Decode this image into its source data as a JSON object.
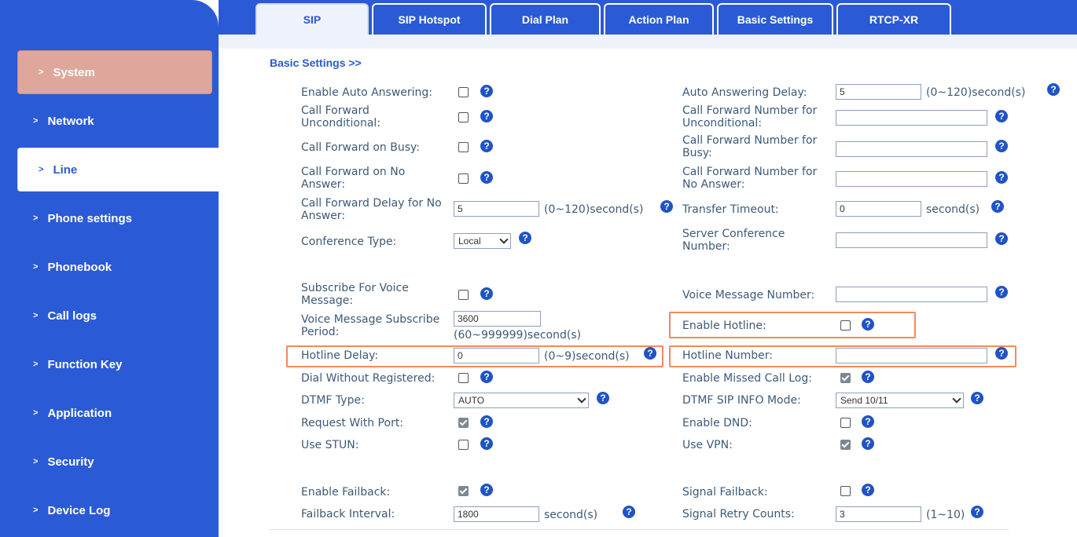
{
  "sidebar": {
    "items": [
      {
        "label": "System"
      },
      {
        "label": "Network"
      },
      {
        "label": "Line"
      },
      {
        "label": "Phone settings"
      },
      {
        "label": "Phonebook"
      },
      {
        "label": "Call logs"
      },
      {
        "label": "Function Key"
      },
      {
        "label": "Application"
      },
      {
        "label": "Security"
      },
      {
        "label": "Device Log"
      }
    ]
  },
  "tabs": [
    {
      "label": "SIP"
    },
    {
      "label": "SIP Hotspot"
    },
    {
      "label": "Dial Plan"
    },
    {
      "label": "Action Plan"
    },
    {
      "label": "Basic Settings"
    },
    {
      "label": "RTCP-XR"
    }
  ],
  "section": {
    "title": "Basic Settings >>"
  },
  "fields": {
    "auto_answering": {
      "label": "Enable Auto Answering:",
      "checked": false
    },
    "cf_unconditional": {
      "label1": "Call Forward",
      "label2": "Unconditional:",
      "checked": false
    },
    "cf_busy": {
      "label": "Call Forward on Busy:",
      "checked": false
    },
    "cf_no_answer": {
      "label1": "Call Forward on No",
      "label2": "Answer:",
      "checked": false
    },
    "cf_delay": {
      "label1": "Call Forward Delay for No",
      "label2": "Answer:",
      "value": "5",
      "unit": "(0~120)second(s)"
    },
    "conference_type": {
      "label": "Conference Type:",
      "value": "Local"
    },
    "subscribe_vm": {
      "label1": "Subscribe For Voice",
      "label2": "Message:",
      "checked": false
    },
    "vm_subscribe_period": {
      "label1": "Voice Message Subscribe",
      "label2": "Period:",
      "value": "3600",
      "unit": "(60~999999)second(s)"
    },
    "hotline_delay": {
      "label": "Hotline Delay:",
      "value": "0",
      "unit": "(0~9)second(s)"
    },
    "dial_without_registered": {
      "label": "Dial Without Registered:",
      "checked": false
    },
    "dtmf_type": {
      "label": "DTMF Type:",
      "value": "AUTO"
    },
    "request_with_port": {
      "label": "Request With Port:",
      "checked": true
    },
    "use_stun": {
      "label": "Use STUN:",
      "checked": false
    },
    "enable_failback": {
      "label": "Enable Failback:",
      "checked": true
    },
    "failback_interval": {
      "label": "Failback Interval:",
      "value": "1800",
      "unit": "second(s)"
    },
    "auto_answer_delay": {
      "label": "Auto Answering Delay:",
      "value": "5",
      "unit": "(0~120)second(s)"
    },
    "cf_number_unconditional": {
      "label1": "Call Forward Number for",
      "label2": "Unconditional:",
      "value": ""
    },
    "cf_number_busy": {
      "label1": "Call Forward Number for",
      "label2": "Busy:",
      "value": ""
    },
    "cf_number_no_answer": {
      "label1": "Call Forward Number for",
      "label2": "No Answer:",
      "value": ""
    },
    "transfer_timeout": {
      "label": "Transfer Timeout:",
      "value": "0",
      "unit": "second(s)"
    },
    "server_conference_number": {
      "label1": "Server Conference",
      "label2": "Number:",
      "value": ""
    },
    "voice_message_number": {
      "label": "Voice Message Number:",
      "value": ""
    },
    "enable_hotline": {
      "label": "Enable Hotline:",
      "checked": false
    },
    "hotline_number": {
      "label": "Hotline Number:",
      "value": ""
    },
    "enable_missed_call_log": {
      "label": "Enable Missed Call Log:",
      "checked": true
    },
    "dtmf_sip_info_mode": {
      "label": "DTMF SIP INFO Mode:",
      "value": "Send 10/11"
    },
    "enable_dnd": {
      "label": "Enable DND:",
      "checked": false
    },
    "use_vpn": {
      "label": "Use VPN:",
      "checked": true
    },
    "signal_failback": {
      "label": "Signal Failback:",
      "checked": false
    },
    "signal_retry_counts": {
      "label": "Signal Retry Counts:",
      "value": "3",
      "unit": "(1~10)"
    }
  },
  "colors": {
    "primary": "#2b5ad6",
    "active_side": "#dfa79c",
    "highlight": "#ef8a5f",
    "text": "#3c5a78"
  }
}
